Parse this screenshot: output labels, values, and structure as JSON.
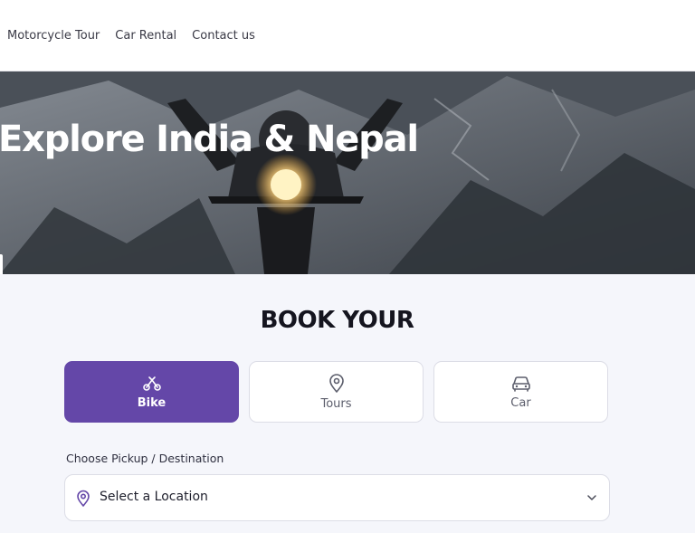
{
  "nav": {
    "items": [
      "Motorcycle Tour",
      "Car Rental",
      "Contact us"
    ]
  },
  "hero": {
    "title": "Explore India & Nepal"
  },
  "booking": {
    "title": "BOOK YOUR",
    "tabs": [
      {
        "label": "Bike",
        "icon": "bike-icon",
        "active": true
      },
      {
        "label": "Tours",
        "icon": "map-pin-icon",
        "active": false
      },
      {
        "label": "Car",
        "icon": "car-icon",
        "active": false
      }
    ],
    "location_label": "Choose Pickup / Destination",
    "location_value": "Select a Location"
  },
  "colors": {
    "accent": "#6447a8",
    "section_bg": "#f5f6fb"
  }
}
